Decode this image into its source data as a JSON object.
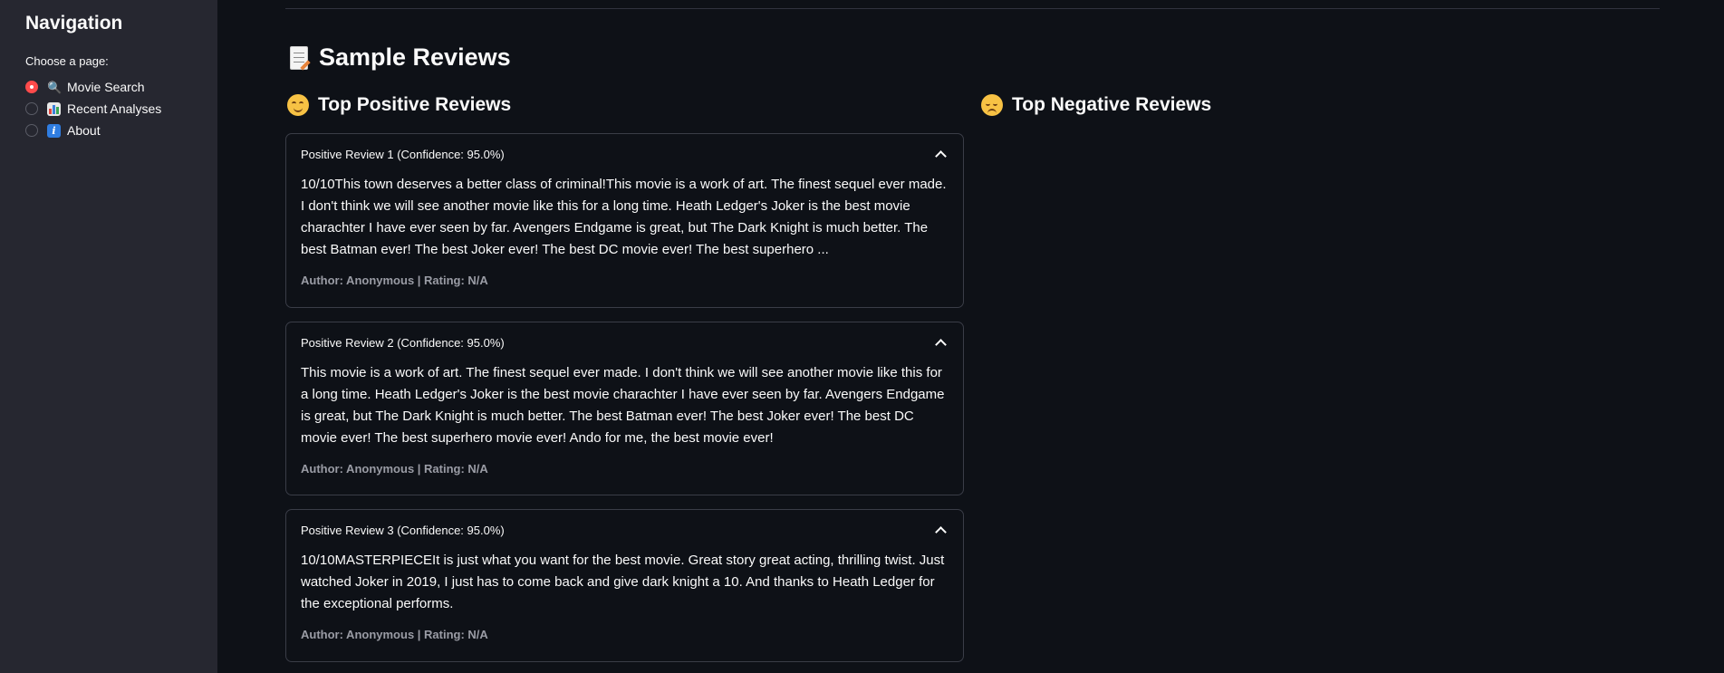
{
  "sidebar": {
    "title": "Navigation",
    "choose_label": "Choose a page:",
    "options": [
      {
        "label": "Movie Search",
        "icon": "magnifier-icon",
        "selected": true
      },
      {
        "label": "Recent Analyses",
        "icon": "bar-chart-icon",
        "selected": false
      },
      {
        "label": "About",
        "icon": "info-icon",
        "selected": false
      }
    ]
  },
  "main": {
    "title": "Sample Reviews",
    "positive_heading": "Top Positive Reviews",
    "negative_heading": "Top Negative Reviews",
    "positive_reviews": [
      {
        "header": "Positive Review 1 (Confidence: 95.0%)",
        "text": "10/10This town deserves a better class of criminal!This movie is a work of art. The finest sequel ever made. I don't think we will see another movie like this for a long time. Heath Ledger's Joker is the best movie charachter I have ever seen by far. Avengers Endgame is great, but The Dark Knight is much better. The best Batman ever! The best Joker ever! The best DC movie ever! The best superhero ...",
        "meta": "Author: Anonymous | Rating: N/A"
      },
      {
        "header": "Positive Review 2 (Confidence: 95.0%)",
        "text": "This movie is a work of art. The finest sequel ever made. I don't think we will see another movie like this for a long time. Heath Ledger's Joker is the best movie charachter I have ever seen by far. Avengers Endgame is great, but The Dark Knight is much better. The best Batman ever! The best Joker ever! The best DC movie ever! The best superhero movie ever! Ando for me, the best movie ever!",
        "meta": "Author: Anonymous | Rating: N/A"
      },
      {
        "header": "Positive Review 3 (Confidence: 95.0%)",
        "text": "10/10MASTERPIECEIt is just what you want for the best movie. Great story great acting, thrilling twist. Just watched Joker in 2019, I just has to come back and give dark knight a 10. And thanks to Heath Ledger for the exceptional performs.",
        "meta": "Author: Anonymous | Rating: N/A"
      }
    ]
  },
  "colors": {
    "background": "#0e1117",
    "sidebar": "#262730",
    "accent": "#ff4b4b"
  }
}
